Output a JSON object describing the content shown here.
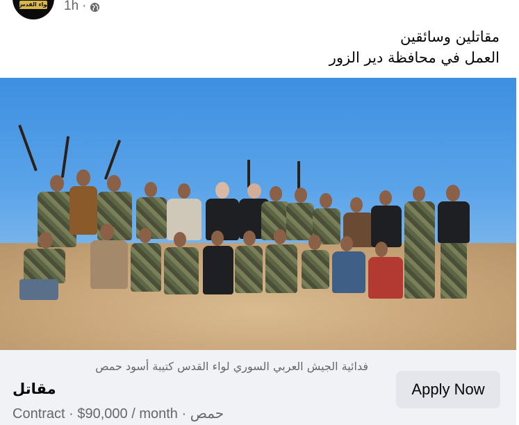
{
  "header": {
    "avatar_text": "لواء القدس",
    "timestamp": "1h",
    "separator": "·",
    "audience_icon": "globe-icon"
  },
  "post": {
    "line1": "مقاتلين وسائقين",
    "line2": "العمل في محافظة دير الزور"
  },
  "listing": {
    "subtitle": "فدائية الجيش العربي السوري لواء القدس كتيبة أسود حمص",
    "title": "مقاتل",
    "details": "Contract · $90,000 / month · حمص",
    "apply_label": "Apply Now"
  },
  "colors": {
    "footer_bg": "#f0f2f5",
    "button_bg": "#e4e6eb",
    "secondary_text": "#65676b"
  }
}
